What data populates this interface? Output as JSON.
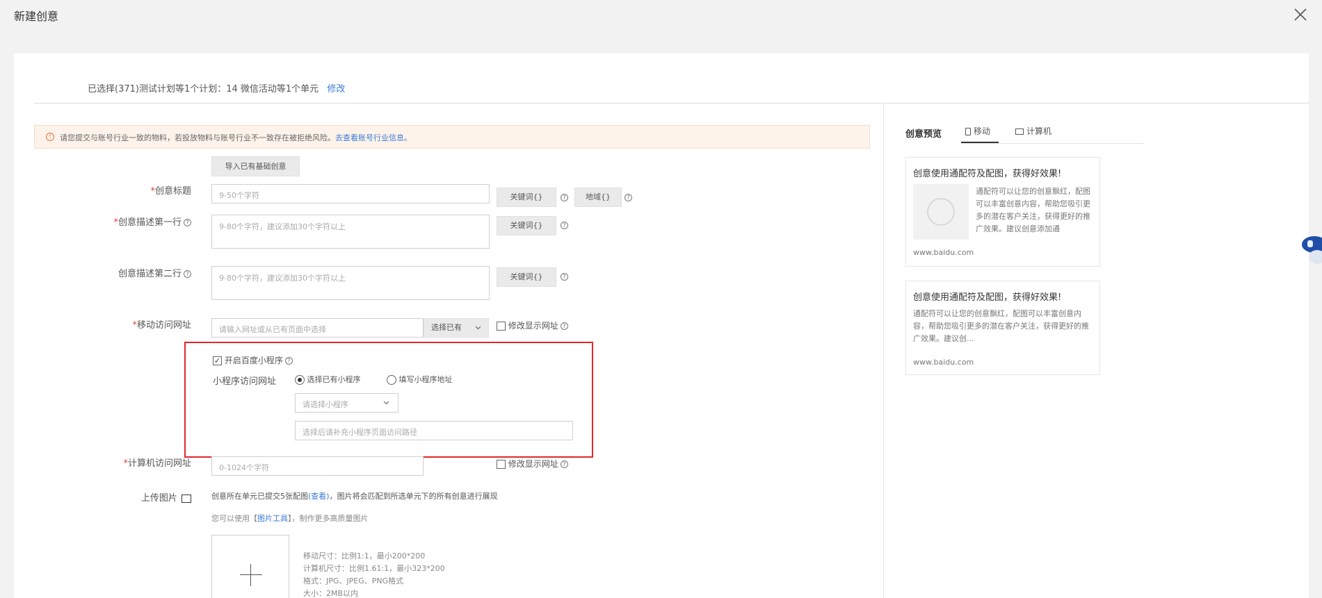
{
  "dialog": {
    "title": "新建创意"
  },
  "selection": {
    "text": "已选择(371)测试计划等1个计划：14 微信活动等1个单元",
    "edit_link": "修改"
  },
  "warning": {
    "text": "请您提交与账号行业一致的物料，若投放物料与账号行业不一致存在被拒绝风险。",
    "link": "去查看账号行业信息。"
  },
  "import_button": "导入已有基础创意",
  "form": {
    "title": {
      "label": "创意标题",
      "placeholder": "9-50个字符",
      "keyword_btn": "关键词{}",
      "region_btn": "地域{}"
    },
    "desc1": {
      "label": "创意描述第一行",
      "placeholder": "9-80个字符，建议添加30个字符以上",
      "keyword_btn": "关键词{}"
    },
    "desc2": {
      "label": "创意描述第二行",
      "placeholder": "9-80个字符，建议添加30个字符以上",
      "keyword_btn": "关键词{}"
    },
    "mobile_url": {
      "label": "移动访问网址",
      "placeholder": "请输入网址或从已有页面中选择",
      "select_label": "选择已有",
      "modify_display": "修改显示网址"
    },
    "mini_program": {
      "enable_label": "开启百度小程序",
      "url_label": "小程序访问网址",
      "option_existing": "选择已有小程序",
      "option_fill": "填写小程序地址",
      "select_placeholder": "请选择小程序",
      "path_placeholder": "选择后请补充小程序页面访问路径"
    },
    "pc_url": {
      "label": "计算机访问网址",
      "placeholder": "0-1024个字符",
      "modify_display": "修改显示网址"
    },
    "upload": {
      "label": "上传图片",
      "note_prefix": "创意所在单元已提交5张配图",
      "note_link": "(查看)",
      "note_suffix": "，图片将会匹配到所选单元下的所有创意进行展现",
      "tool_prefix": "您可以使用【",
      "tool_link": "图片工具",
      "tool_suffix": "】，制作更多高质量图片",
      "spec_mobile": "移动尺寸：比例1:1，最小200*200",
      "spec_pc": "计算机尺寸：比例1.61:1，最小323*200",
      "spec_format": "格式：JPG、JPEG、PNG格式",
      "spec_size": "大小：2MB以内"
    }
  },
  "preview": {
    "title": "创意预览",
    "tab_mobile": "移动",
    "tab_pc": "计算机",
    "card1": {
      "title": "创意使用通配符及配图，获得好效果!",
      "desc": "通配符可以让您的创意飘红，配图可以丰富创意内容，帮助您吸引更多的潜在客户关注，获得更好的推广效果。建议创意添加通",
      "url": "www.baidu.com"
    },
    "card2": {
      "title": "创意使用通配符及配图，获得好效果!",
      "desc": "通配符可以让您的创意飘红，配图可以丰富创意内容，帮助您吸引更多的潜在客户关注，获得更好的推广效果。建议创...",
      "url": "www.baidu.com"
    }
  },
  "colors": {
    "accent": "#3a7bd5",
    "required": "#e0433a",
    "highlight_box": "#e0262b",
    "warning_bg": "#fdf3ea"
  }
}
